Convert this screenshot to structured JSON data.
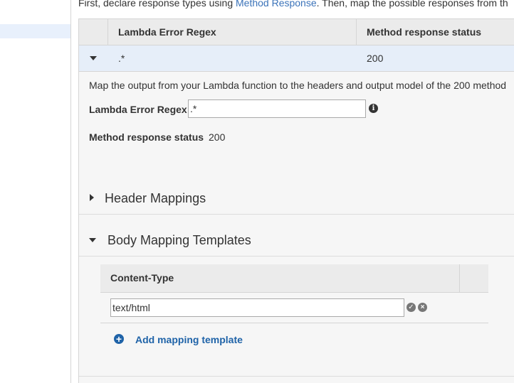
{
  "intro": {
    "prefix": "First, declare response types using ",
    "link": "Method Response",
    "suffix": ". Then, map the possible responses from th"
  },
  "responses_table": {
    "headers": [
      "Lambda Error Regex",
      "Method response status"
    ],
    "rows": [
      {
        "regex": ".*",
        "status": "200",
        "expanded": true
      }
    ]
  },
  "detail": {
    "description": "Map the output from your Lambda function to the headers and output model of the 200 method",
    "regex_label": "Lambda Error Regex",
    "regex_value": ".*",
    "status_label": "Method response status",
    "status_value": "200"
  },
  "sections": {
    "header_mappings": {
      "title": "Header Mappings",
      "expanded": false
    },
    "body_mapping_templates": {
      "title": "Body Mapping Templates",
      "expanded": true
    }
  },
  "content_type_table": {
    "header": "Content-Type",
    "rows": [
      {
        "value": "text/html"
      }
    ]
  },
  "add_mapping": {
    "label": "Add mapping template"
  },
  "icons": {
    "info": "info-icon",
    "confirm": "check-circle-icon",
    "remove": "x-circle-icon",
    "add": "plus-circle-icon"
  },
  "colors": {
    "link": "#3b73b9",
    "accent": "#1f63a8",
    "selected_row": "#e6eef9",
    "panel_bg": "#f6f6f6"
  }
}
